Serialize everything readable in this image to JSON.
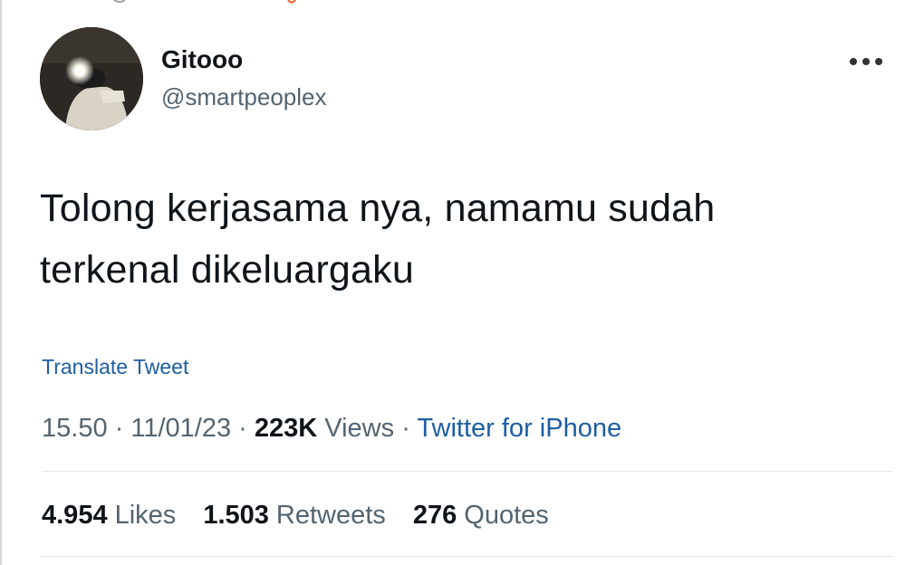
{
  "tweet": {
    "display_name": "Gitooo",
    "handle": "@smartpeoplex",
    "text_lines": [
      "Tolong kerjasama nya, namamu sudah",
      "terkenal dikeluargaku"
    ],
    "translate_label": "Translate Tweet",
    "time": "15.50",
    "date": "11/01/23",
    "views_count": "223K",
    "views_label": "Views",
    "source": "Twitter for iPhone",
    "separator": "·"
  },
  "stats": {
    "likes_count": "4.954",
    "likes_label": "Likes",
    "retweets_count": "1.503",
    "retweets_label": "Retweets",
    "quotes_count": "276",
    "quotes_label": "Quotes"
  },
  "icons": {
    "more": "more-horizontal-icon"
  },
  "colors": {
    "link": "#1d5ea3",
    "secondary_text": "#536471",
    "primary_text": "#0f1419"
  }
}
